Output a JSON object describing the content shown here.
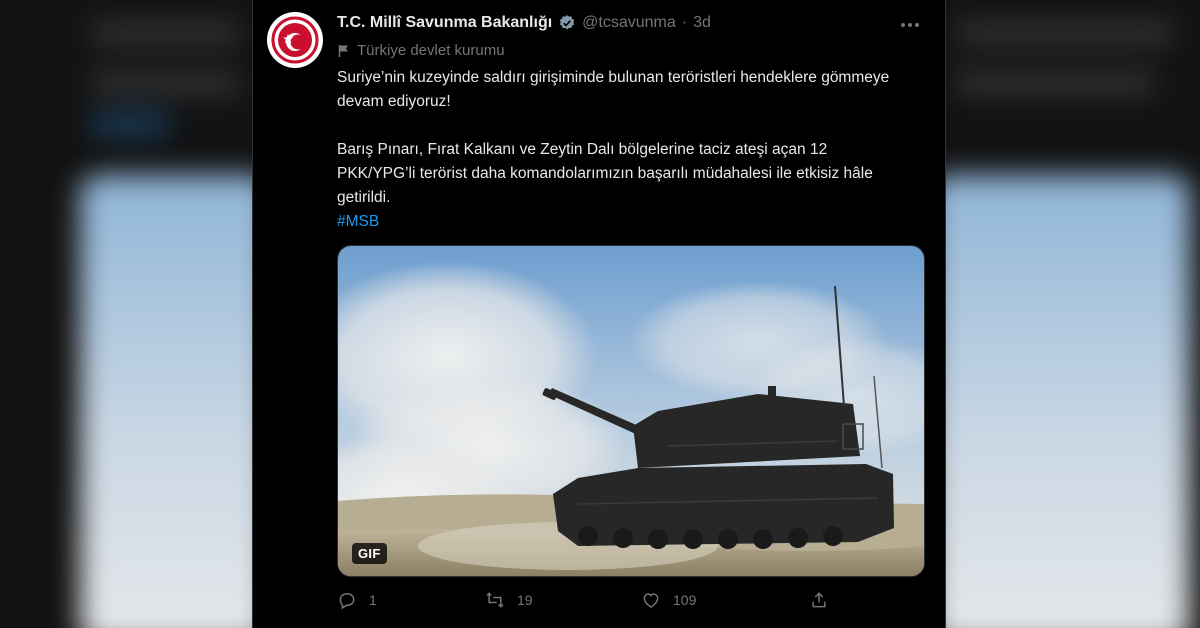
{
  "tweet": {
    "display_name": "T.C. Millî Savunma Bakanlığı",
    "handle": "@tcsavunma",
    "separator": "·",
    "time": "3d",
    "affiliation": "Türkiye devlet kurumu",
    "text_para1": "Suriye’nin kuzeyinde saldırı girişiminde bulunan teröristleri hendeklere gömmeye devam ediyoruz!",
    "text_para2": "Barış Pınarı, Fırat Kalkanı ve Zeytin Dalı bölgelerine taciz ateşi açan 12 PKK/YPG’li terörist daha komandolarımızın başarılı müdahalesi ile etkisiz hâle getirildi.",
    "hashtag": "#MSB",
    "media_badge": "GIF",
    "stats": {
      "replies": "1",
      "retweets": "19",
      "likes": "109"
    }
  },
  "icons": {
    "avatar": "ministry-emblem-icon",
    "verified": "verified-badge-icon",
    "more": "more-options-icon",
    "affiliation": "flag-icon",
    "reply": "reply-icon",
    "retweet": "retweet-icon",
    "like": "like-icon",
    "share": "share-icon"
  },
  "colors": {
    "background": "#000000",
    "text": "#e7e9ea",
    "muted": "#71767b",
    "link": "#1d9bf0",
    "emblem_red": "#c8102e"
  }
}
